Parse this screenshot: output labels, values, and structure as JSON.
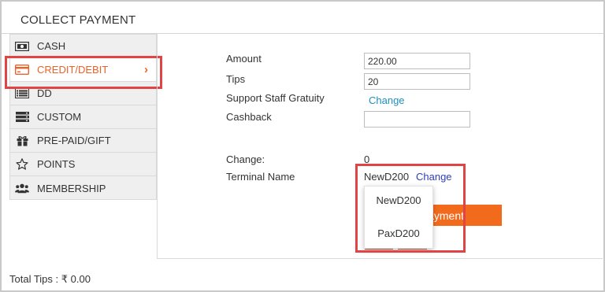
{
  "header": {
    "title": "COLLECT PAYMENT"
  },
  "sidebar": {
    "items": [
      {
        "label": "CASH",
        "icon": "cash-icon"
      },
      {
        "label": "CREDIT/DEBIT",
        "icon": "credit-card-icon",
        "active": true
      },
      {
        "label": "DD",
        "icon": "list-icon"
      },
      {
        "label": "CUSTOM",
        "icon": "custom-icon"
      },
      {
        "label": "PRE-PAID/GIFT",
        "icon": "gift-icon"
      },
      {
        "label": "POINTS",
        "icon": "star-icon"
      },
      {
        "label": "MEMBERSHIP",
        "icon": "users-icon"
      }
    ]
  },
  "form": {
    "amount_label": "Amount",
    "amount_value": "220.00",
    "tips_label": "Tips",
    "tips_value": "20",
    "gratuity_label": "Support Staff Gratuity",
    "gratuity_link": "Change",
    "cashback_label": "Cashback",
    "cashback_value": "",
    "change_label": "Change:",
    "change_value": "0",
    "terminal_label": "Terminal Name",
    "terminal_value": "NewD200",
    "terminal_link": "Change"
  },
  "terminal_dropdown": {
    "options": [
      "NewD200",
      "PaxD200"
    ]
  },
  "pay_button": {
    "label": "ayment"
  },
  "footer": {
    "total_tips": "Total Tips : ₹ 0.00"
  },
  "colors": {
    "accent": "#f26b1d",
    "link": "#1f8fbf",
    "highlight": "#e04444"
  }
}
